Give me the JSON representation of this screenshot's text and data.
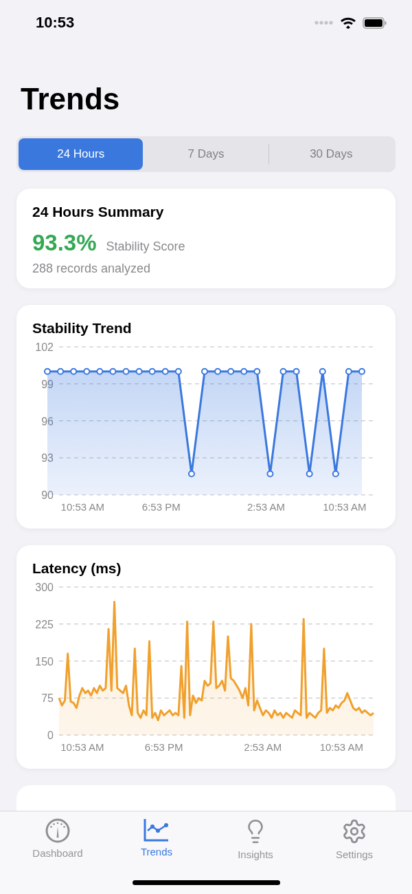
{
  "status_bar": {
    "time": "10:53"
  },
  "title": "Trends",
  "segments": [
    {
      "label": "24 Hours",
      "selected": true
    },
    {
      "label": "7 Days",
      "selected": false
    },
    {
      "label": "30 Days",
      "selected": false
    }
  ],
  "summary": {
    "title": "24 Hours Summary",
    "score": "93.3%",
    "score_label": "Stability Score",
    "records": "288 records analyzed"
  },
  "charts": [
    {
      "title": "Stability Trend",
      "chart_data": {
        "type": "area",
        "grid": true,
        "categories": [
          null,
          null,
          null,
          "10:53 AM",
          null,
          null,
          null,
          null,
          null,
          "6:53 PM",
          null,
          null,
          null,
          null,
          null,
          null,
          null,
          "2:53 AM",
          null,
          null,
          null,
          null,
          null,
          "10:53 AM",
          null
        ],
        "series": [
          {
            "color": "#3a78de",
            "values": [
              100,
              100,
              100,
              100,
              100,
              100,
              100,
              100,
              100,
              100,
              100,
              91.7,
              100,
              100,
              100,
              100,
              100,
              91.7,
              100,
              100,
              91.7,
              100,
              91.7,
              100,
              100
            ]
          }
        ],
        "ylim": [
          90,
          102
        ],
        "yticks": [
          90,
          93,
          96,
          99,
          102
        ]
      }
    },
    {
      "title": "Latency (ms)",
      "chart_data": {
        "type": "area",
        "grid": true,
        "categories": [
          null,
          null,
          null,
          null,
          null,
          null,
          null,
          null,
          "10:53 AM",
          null,
          null,
          null,
          null,
          null,
          null,
          null,
          null,
          null,
          null,
          null,
          null,
          null,
          null,
          null,
          null,
          null,
          null,
          null,
          null,
          null,
          null,
          null,
          null,
          null,
          null,
          null,
          "6:53 PM",
          null,
          null,
          null,
          null,
          null,
          null,
          null,
          null,
          null,
          null,
          null,
          null,
          null,
          null,
          null,
          null,
          null,
          null,
          null,
          null,
          null,
          null,
          null,
          null,
          null,
          null,
          null,
          null,
          null,
          null,
          null,
          null,
          null,
          "2:53 AM",
          null,
          null,
          null,
          null,
          null,
          null,
          null,
          null,
          null,
          null,
          null,
          null,
          null,
          null,
          null,
          null,
          null,
          null,
          null,
          null,
          null,
          null,
          null,
          null,
          null,
          null,
          "10:53 AM",
          null,
          null,
          null,
          null,
          null,
          null,
          null,
          null,
          null,
          null,
          null
        ],
        "series": [
          {
            "color": "#f0a02c",
            "values": [
              75,
              60,
              70,
              165,
              68,
              65,
              55,
              80,
              95,
              85,
              90,
              80,
              95,
              85,
              100,
              90,
              95,
              215,
              90,
              270,
              95,
              90,
              85,
              100,
              60,
              40,
              175,
              45,
              35,
              50,
              40,
              190,
              35,
              45,
              30,
              50,
              40,
              45,
              50,
              40,
              45,
              40,
              140,
              35,
              230,
              40,
              80,
              65,
              75,
              70,
              110,
              100,
              105,
              230,
              95,
              100,
              110,
              90,
              200,
              115,
              110,
              100,
              90,
              75,
              95,
              60,
              225,
              50,
              70,
              55,
              40,
              50,
              45,
              35,
              50,
              40,
              45,
              35,
              45,
              40,
              35,
              50,
              45,
              40,
              235,
              35,
              45,
              40,
              35,
              45,
              50,
              175,
              45,
              55,
              50,
              60,
              55,
              65,
              70,
              85,
              70,
              55,
              50,
              55,
              45,
              50,
              45,
              40,
              45
            ]
          }
        ],
        "ylim": [
          0,
          300
        ],
        "yticks": [
          0,
          75,
          150,
          225,
          300
        ]
      }
    }
  ],
  "tab_bar": [
    {
      "label": "Dashboard",
      "selected": false
    },
    {
      "label": "Trends",
      "selected": true
    },
    {
      "label": "Insights",
      "selected": false
    },
    {
      "label": "Settings",
      "selected": false
    }
  ]
}
